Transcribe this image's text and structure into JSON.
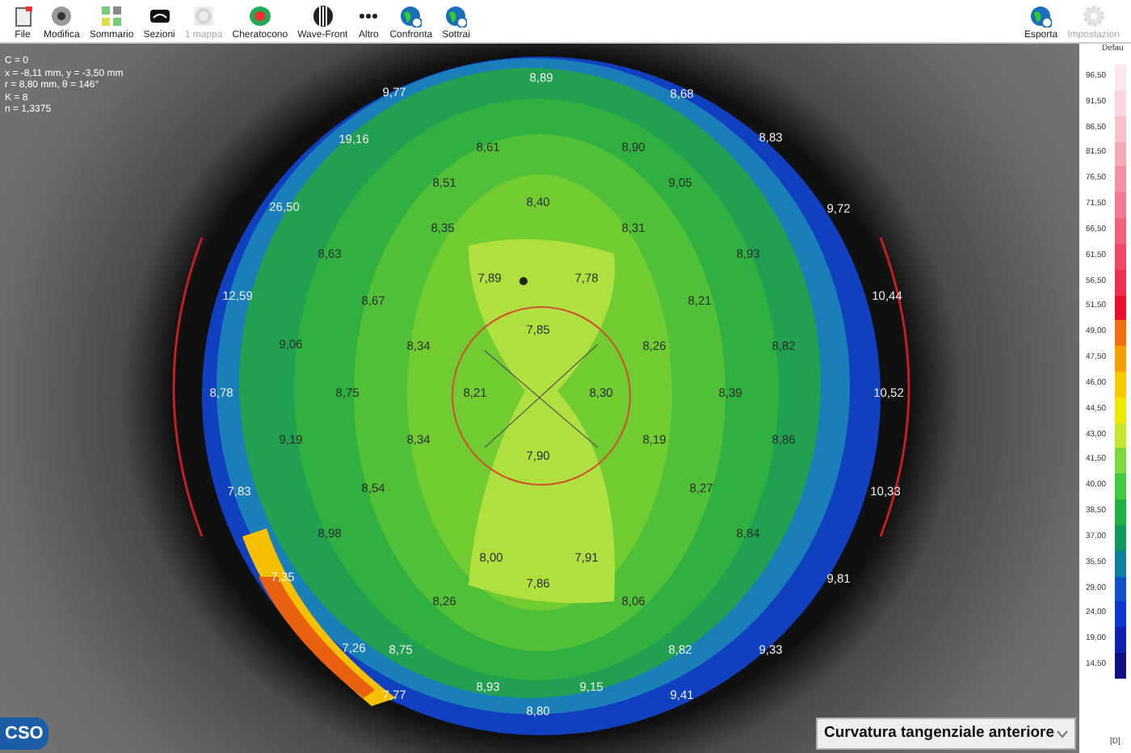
{
  "toolbar": {
    "left": [
      {
        "label": "File",
        "disabled": false
      },
      {
        "label": "Modifica",
        "disabled": false
      },
      {
        "label": "Sommario",
        "disabled": false
      },
      {
        "label": "Sezioni",
        "disabled": false
      },
      {
        "label": "1 mappa",
        "disabled": true
      },
      {
        "label": "Cheratocono",
        "disabled": false
      },
      {
        "label": "Wave-Front",
        "disabled": false
      },
      {
        "label": "Altro",
        "disabled": false
      },
      {
        "label": "Confronta",
        "disabled": false
      },
      {
        "label": "Sottrai",
        "disabled": false
      }
    ],
    "right": [
      {
        "label": "Esporta",
        "disabled": false
      },
      {
        "label": "Impostazion",
        "disabled": true
      }
    ]
  },
  "info_lines": [
    "C = 0",
    "x = -8,11 mm, y = -3,50 mm",
    "r = 8,80 mm, θ = 146°",
    "K = 8",
    "n = 1,3375"
  ],
  "map": {
    "values": [
      "8,89",
      "9,77",
      "8,68",
      "19,16",
      "8,61",
      "8,90",
      "8,83",
      "8,51",
      "9,05",
      "26,50",
      "8,40",
      "9,72",
      "8,35",
      "8,31",
      "8,63",
      "8,93",
      "12,59",
      "8,67",
      "7,89",
      "7,78",
      "8,21",
      "10,44",
      "7,85",
      "9,06",
      "8,34",
      "8,26",
      "8,82",
      "8,78",
      "8,75",
      "8,21",
      "8,30",
      "8,39",
      "10,52",
      "9,19",
      "8,34",
      "8,19",
      "8,86",
      "7,90",
      "7,83",
      "8,54",
      "8,27",
      "10,33",
      "8,98",
      "8,84",
      "8,00",
      "7,91",
      "7,35",
      "7,86",
      "9,81",
      "8,26",
      "8,06",
      "7,26",
      "8,75",
      "8,82",
      "9,33",
      "8,93",
      "9,15",
      "7,77",
      "9,41",
      "8,80"
    ]
  },
  "scale": {
    "title": "Defau",
    "footer": "[D]",
    "steps": [
      {
        "label": "96,50",
        "color": "#fbe8ee"
      },
      {
        "label": "91,50",
        "color": "#f9d6de"
      },
      {
        "label": "86,50",
        "color": "#f7c0cc"
      },
      {
        "label": "81,50",
        "color": "#f5a8b8"
      },
      {
        "label": "76,50",
        "color": "#f390a4"
      },
      {
        "label": "71,50",
        "color": "#f17890"
      },
      {
        "label": "66,50",
        "color": "#ef607c"
      },
      {
        "label": "61,50",
        "color": "#ed4866"
      },
      {
        "label": "56,50",
        "color": "#eb3050"
      },
      {
        "label": "51,50",
        "color": "#e8102a"
      },
      {
        "label": "49,00",
        "color": "#f07010"
      },
      {
        "label": "47,50",
        "color": "#f5a000"
      },
      {
        "label": "46,00",
        "color": "#f8c800"
      },
      {
        "label": "44,50",
        "color": "#f0e800"
      },
      {
        "label": "43,00",
        "color": "#c8e830"
      },
      {
        "label": "41,50",
        "color": "#80d840"
      },
      {
        "label": "40,00",
        "color": "#40c840"
      },
      {
        "label": "38,50",
        "color": "#20b048"
      },
      {
        "label": "37,00",
        "color": "#109858"
      },
      {
        "label": "35,50",
        "color": "#1080a0"
      },
      {
        "label": "29,00",
        "color": "#1050c8"
      },
      {
        "label": "24,00",
        "color": "#1038d0"
      },
      {
        "label": "19,00",
        "color": "#1020b0"
      },
      {
        "label": "14,50",
        "color": "#101080"
      }
    ]
  },
  "logo": "CSO",
  "map_type": {
    "value": "Curvatura tangenziale anteriore"
  }
}
